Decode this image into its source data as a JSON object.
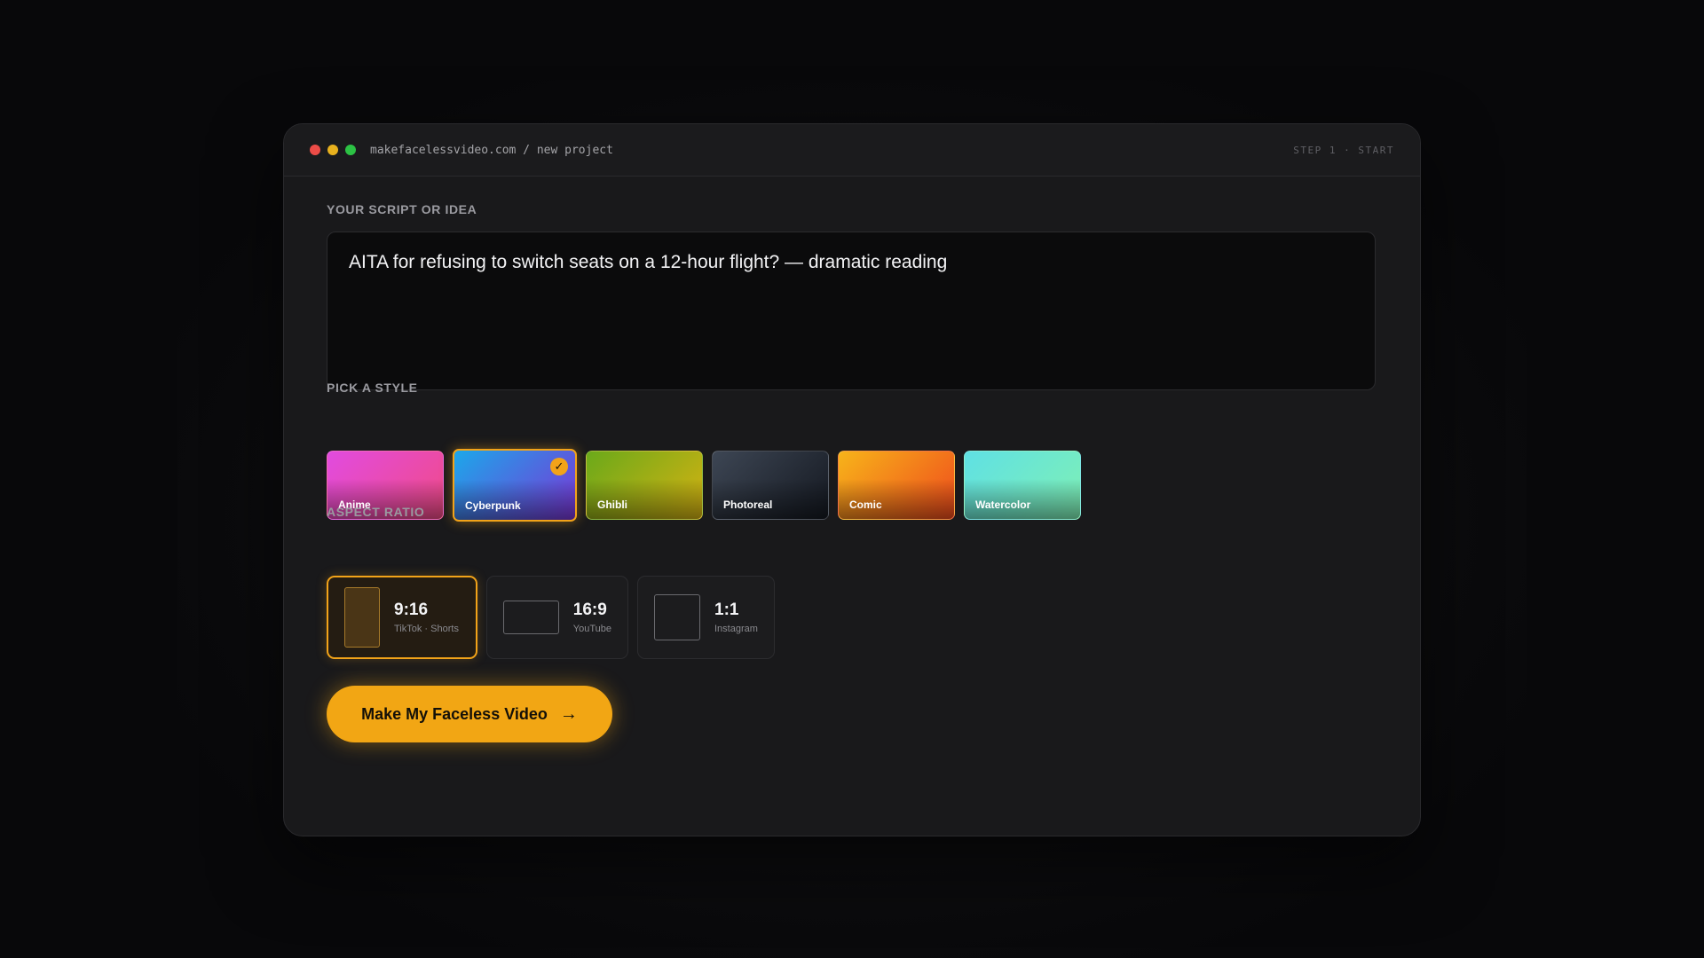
{
  "window": {
    "url": "makefacelessvideo.com / new project",
    "step": "STEP 1 · START"
  },
  "script_section": {
    "label": "YOUR SCRIPT OR IDEA",
    "value": "AITA for refusing to switch seats on a 12-hour flight? — dramatic reading"
  },
  "style_section": {
    "label": "PICK A STYLE",
    "selected": "Cyberpunk",
    "styles": [
      {
        "name": "Anime",
        "colors": [
          "#e14be0",
          "#f14b86"
        ]
      },
      {
        "name": "Cyberpunk",
        "colors": [
          "#1ba8ea",
          "#7b35d6"
        ]
      },
      {
        "name": "Ghibli",
        "colors": [
          "#6aa91a",
          "#d6b212"
        ]
      },
      {
        "name": "Photoreal",
        "colors": [
          "#3d4654",
          "#141820"
        ]
      },
      {
        "name": "Comic",
        "colors": [
          "#f7b41a",
          "#ef4a1c"
        ]
      },
      {
        "name": "Watercolor",
        "colors": [
          "#5fe0e4",
          "#7ff0b4"
        ]
      }
    ]
  },
  "ratio_section": {
    "label": "ASPECT RATIO",
    "selected": "9:16",
    "ratios": [
      {
        "name": "9:16",
        "sub": "TikTok · Shorts",
        "icon": "portrait-frame-icon"
      },
      {
        "name": "16:9",
        "sub": "YouTube",
        "icon": "landscape-frame-icon"
      },
      {
        "name": "1:1",
        "sub": "Instagram",
        "icon": "square-frame-icon"
      }
    ]
  },
  "cta": {
    "label": "Make My Faceless Video",
    "icon": "arrow-right-icon",
    "arrow": "→"
  },
  "colors": {
    "accent": "#f2a614",
    "background": "#08080a",
    "window": "#19191b"
  }
}
